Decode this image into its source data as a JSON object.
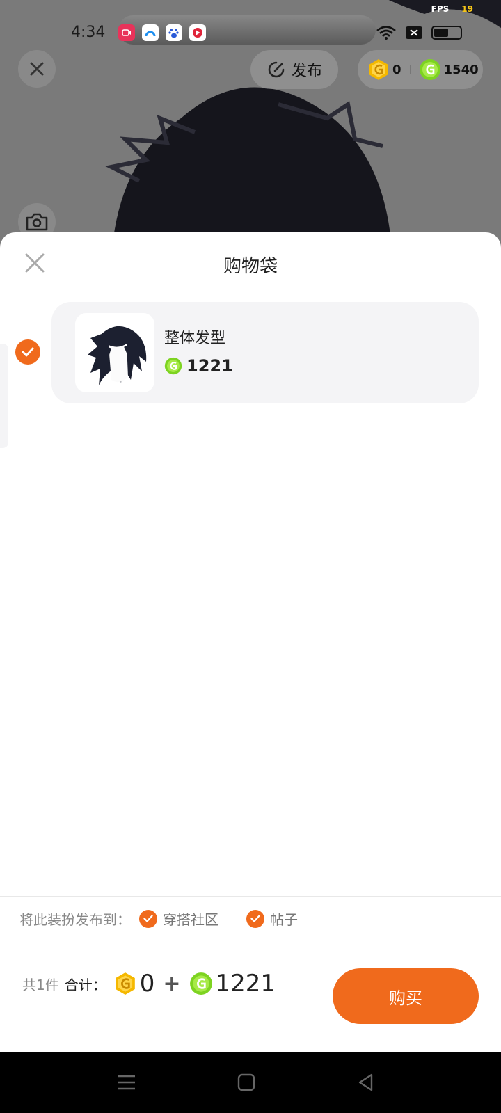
{
  "status_bar": {
    "fps_label": "FPS",
    "fps_value": "19",
    "time": "4:34",
    "app_icons": [
      "screen-recorder-icon",
      "browser-icon",
      "baidu-icon",
      "video-app-icon"
    ]
  },
  "top_bar": {
    "publish_label": "发布",
    "coin_gold": "0",
    "coin_green": "1540"
  },
  "sheet": {
    "title": "购物袋",
    "items": [
      {
        "name": "整体发型",
        "price": "1221",
        "selected": true,
        "currency_icon": "green-coin-icon"
      }
    ]
  },
  "publish_to": {
    "label": "将此装扮发布到：",
    "options": [
      {
        "label": "穿搭社区",
        "checked": true
      },
      {
        "label": "帖子",
        "checked": true
      }
    ]
  },
  "summary": {
    "count_text": "共1件",
    "total_label": "合计：",
    "gold_amount": "0",
    "plus": "+",
    "green_amount": "1221",
    "buy_label": "购买"
  },
  "colors": {
    "accent": "#F06A1C",
    "gold_coin": "#F5B800",
    "green_coin": "#7DD321"
  }
}
